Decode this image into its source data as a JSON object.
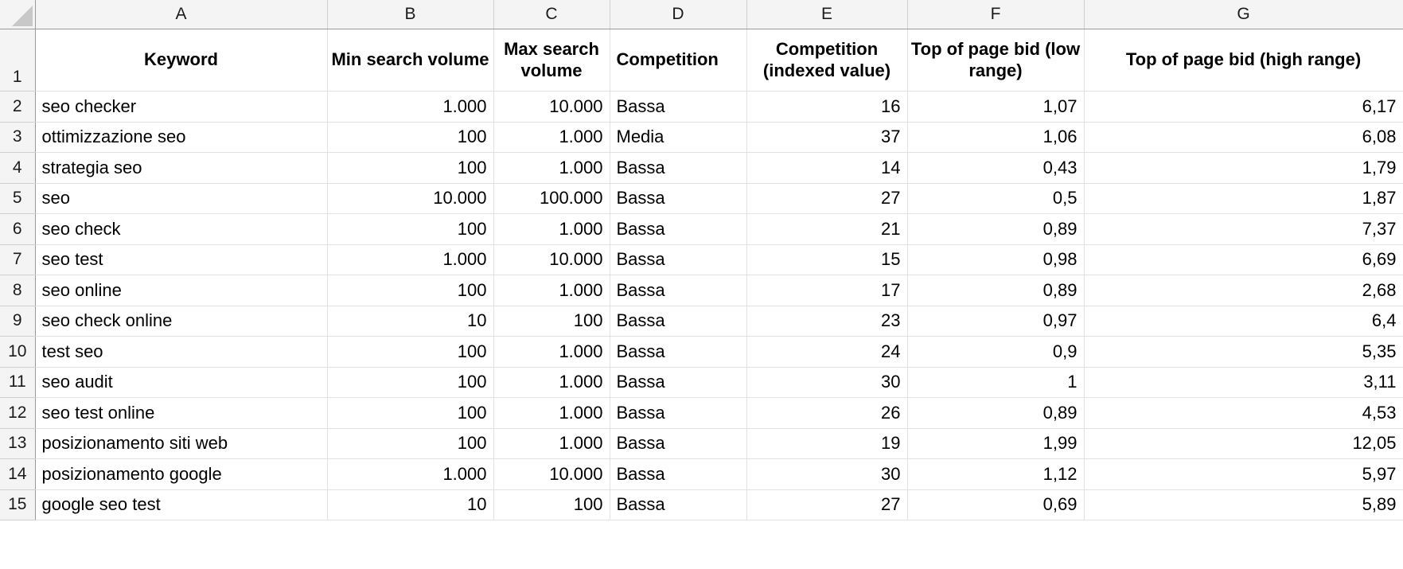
{
  "spreadsheet": {
    "select_all_icon": "select-all-triangle",
    "column_letters": [
      "A",
      "B",
      "C",
      "D",
      "E",
      "F",
      "G"
    ],
    "row_numbers": [
      "1",
      "2",
      "3",
      "4",
      "5",
      "6",
      "7",
      "8",
      "9",
      "10",
      "11",
      "12",
      "13",
      "14",
      "15"
    ],
    "headers": {
      "A": "Keyword",
      "B": "Min search volume",
      "C": "Max search volume",
      "D": "Competition",
      "E": "Competition (indexed value)",
      "F": "Top of page bid (low range)",
      "G": "Top of page bid (high range)"
    },
    "rows": [
      {
        "row": "2",
        "keyword": "seo checker",
        "min_search_volume": "1.000",
        "max_search_volume": "10.000",
        "competition": "Bassa",
        "competition_indexed": "16",
        "bid_low": "1,07",
        "bid_high": "6,17"
      },
      {
        "row": "3",
        "keyword": "ottimizzazione seo",
        "min_search_volume": "100",
        "max_search_volume": "1.000",
        "competition": "Media",
        "competition_indexed": "37",
        "bid_low": "1,06",
        "bid_high": "6,08"
      },
      {
        "row": "4",
        "keyword": "strategia seo",
        "min_search_volume": "100",
        "max_search_volume": "1.000",
        "competition": "Bassa",
        "competition_indexed": "14",
        "bid_low": "0,43",
        "bid_high": "1,79"
      },
      {
        "row": "5",
        "keyword": "seo",
        "min_search_volume": "10.000",
        "max_search_volume": "100.000",
        "competition": "Bassa",
        "competition_indexed": "27",
        "bid_low": "0,5",
        "bid_high": "1,87"
      },
      {
        "row": "6",
        "keyword": "seo check",
        "min_search_volume": "100",
        "max_search_volume": "1.000",
        "competition": "Bassa",
        "competition_indexed": "21",
        "bid_low": "0,89",
        "bid_high": "7,37"
      },
      {
        "row": "7",
        "keyword": "seo test",
        "min_search_volume": "1.000",
        "max_search_volume": "10.000",
        "competition": "Bassa",
        "competition_indexed": "15",
        "bid_low": "0,98",
        "bid_high": "6,69"
      },
      {
        "row": "8",
        "keyword": "seo online",
        "min_search_volume": "100",
        "max_search_volume": "1.000",
        "competition": "Bassa",
        "competition_indexed": "17",
        "bid_low": "0,89",
        "bid_high": "2,68"
      },
      {
        "row": "9",
        "keyword": "seo check online",
        "min_search_volume": "10",
        "max_search_volume": "100",
        "competition": "Bassa",
        "competition_indexed": "23",
        "bid_low": "0,97",
        "bid_high": "6,4"
      },
      {
        "row": "10",
        "keyword": "test seo",
        "min_search_volume": "100",
        "max_search_volume": "1.000",
        "competition": "Bassa",
        "competition_indexed": "24",
        "bid_low": "0,9",
        "bid_high": "5,35"
      },
      {
        "row": "11",
        "keyword": "seo audit",
        "min_search_volume": "100",
        "max_search_volume": "1.000",
        "competition": "Bassa",
        "competition_indexed": "30",
        "bid_low": "1",
        "bid_high": "3,11"
      },
      {
        "row": "12",
        "keyword": "seo test online",
        "min_search_volume": "100",
        "max_search_volume": "1.000",
        "competition": "Bassa",
        "competition_indexed": "26",
        "bid_low": "0,89",
        "bid_high": "4,53"
      },
      {
        "row": "13",
        "keyword": "posizionamento siti web",
        "min_search_volume": "100",
        "max_search_volume": "1.000",
        "competition": "Bassa",
        "competition_indexed": "19",
        "bid_low": "1,99",
        "bid_high": "12,05"
      },
      {
        "row": "14",
        "keyword": "posizionamento google",
        "min_search_volume": "1.000",
        "max_search_volume": "10.000",
        "competition": "Bassa",
        "competition_indexed": "30",
        "bid_low": "1,12",
        "bid_high": "5,97"
      },
      {
        "row": "15",
        "keyword": "google seo test",
        "min_search_volume": "10",
        "max_search_volume": "100",
        "competition": "Bassa",
        "competition_indexed": "27",
        "bid_low": "0,69",
        "bid_high": "5,89"
      }
    ]
  }
}
